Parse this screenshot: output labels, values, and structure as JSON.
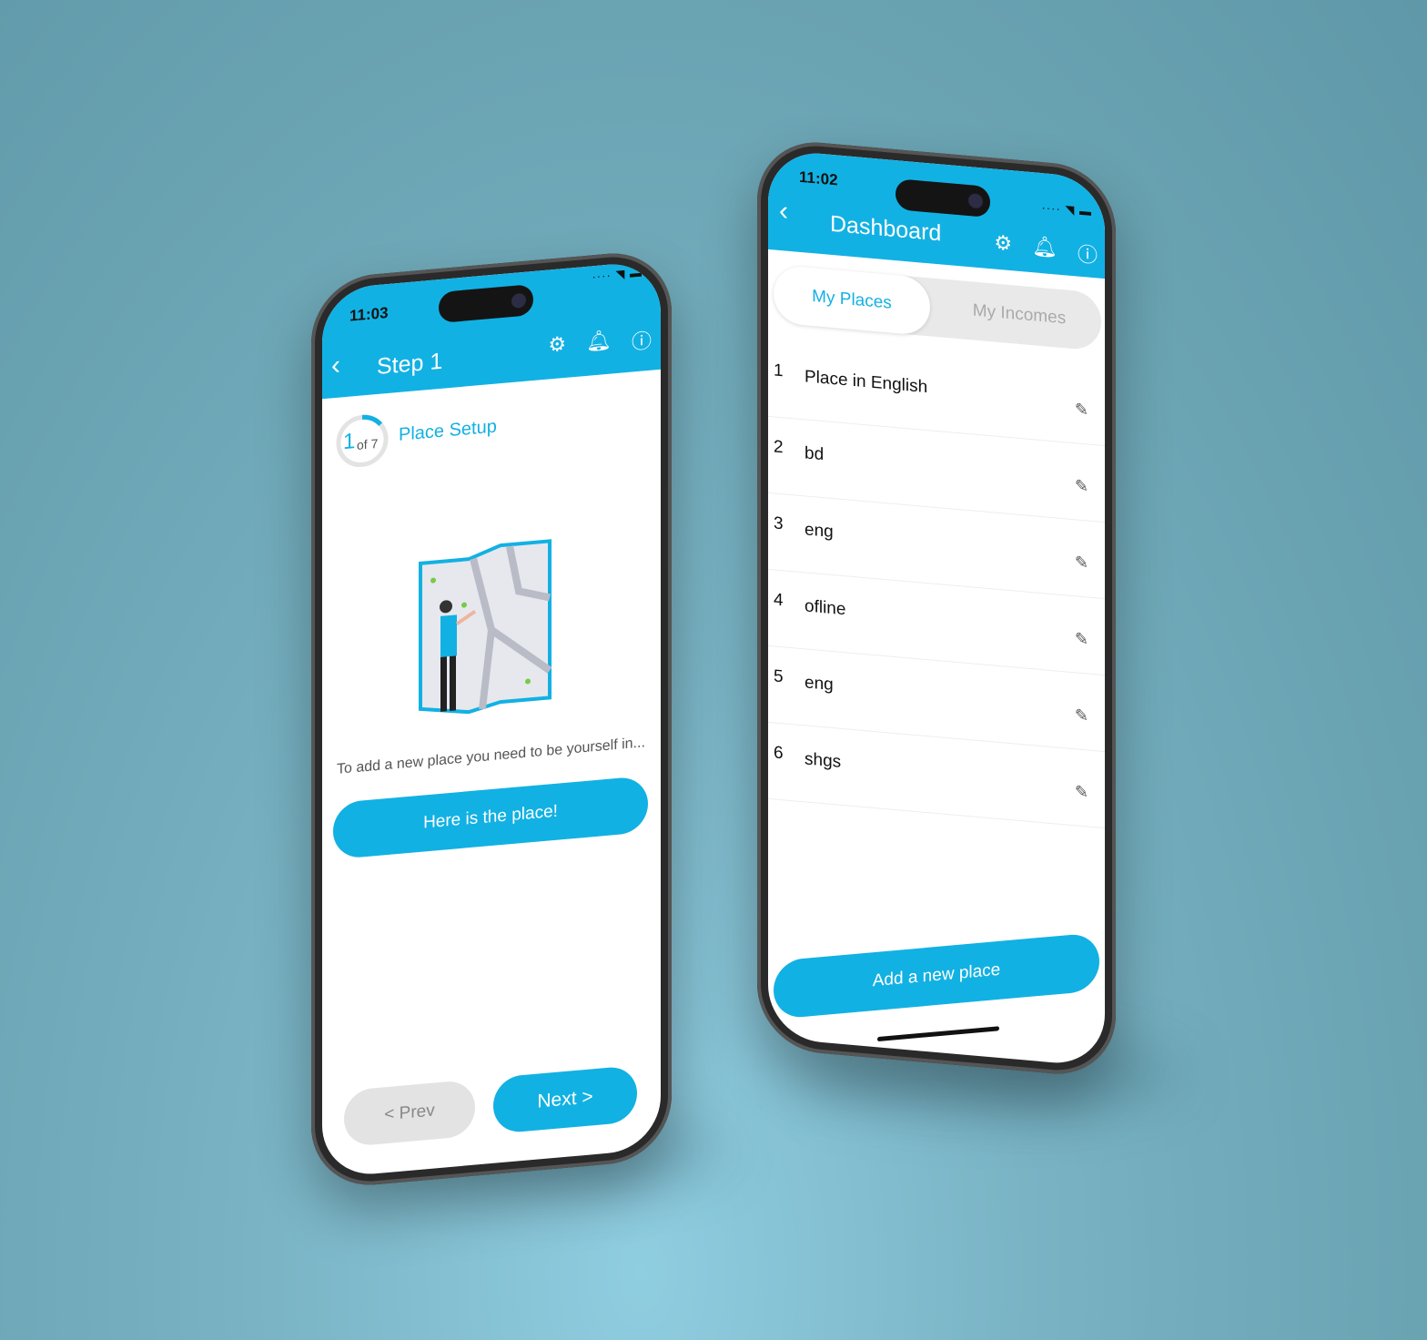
{
  "left_phone": {
    "status": {
      "time": "11:03"
    },
    "header": {
      "title": "Step 1",
      "back_icon": "chevron-left-icon",
      "icons": [
        "gear-icon",
        "bell-icon",
        "help-icon"
      ]
    },
    "progress": {
      "current": "1",
      "of_label": "of 7",
      "fraction": 0.143,
      "title": "Place Setup"
    },
    "description": "To add a new place you need to be yourself in...",
    "primary_button": "Here is the place!",
    "prev_button": "< Prev",
    "next_button": "Next >"
  },
  "right_phone": {
    "status": {
      "time": "11:02"
    },
    "header": {
      "title": "Dashboard",
      "back_icon": "chevron-left-icon",
      "icons": [
        "gear-icon",
        "bell-icon",
        "help-icon"
      ]
    },
    "tabs": [
      {
        "label": "My Places",
        "active": true
      },
      {
        "label": "My Incomes",
        "active": false
      }
    ],
    "places": [
      {
        "index": "1",
        "name": "Place in English"
      },
      {
        "index": "2",
        "name": "bd"
      },
      {
        "index": "3",
        "name": "eng"
      },
      {
        "index": "4",
        "name": "ofline"
      },
      {
        "index": "5",
        "name": "eng"
      },
      {
        "index": "6",
        "name": "shgs"
      }
    ],
    "add_button": "Add a new place"
  },
  "colors": {
    "accent": "#12b1e3",
    "inactive": "#e3e3e3"
  }
}
